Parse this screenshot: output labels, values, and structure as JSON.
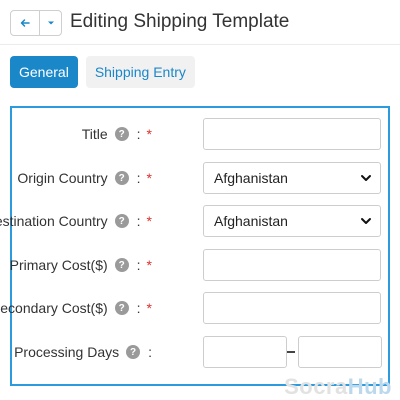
{
  "header": {
    "title": "Editing Shipping Template",
    "back_icon": "arrow-left-icon",
    "dropdown_icon": "caret-down-icon"
  },
  "tabs": [
    {
      "label": "General",
      "active": true
    },
    {
      "label": "Shipping Entry",
      "active": false
    }
  ],
  "form": {
    "title": {
      "label": "Title",
      "value": ""
    },
    "origin_country": {
      "label": "Origin Country",
      "value": "Afghanistan"
    },
    "destination_country": {
      "label": "Destination Country",
      "value": "Afghanistan"
    },
    "primary_cost": {
      "label": "Primary Cost($)",
      "value": ""
    },
    "secondary_cost": {
      "label": "Secondary Cost($)",
      "value": ""
    },
    "processing_days": {
      "label": "Processing Days",
      "min": "",
      "max": ""
    }
  },
  "symbols": {
    "help": "?",
    "colon": ":",
    "required": "*"
  },
  "watermark": {
    "part1": "Socra",
    "part2": "Hub"
  },
  "colors": {
    "accent": "#1a87c9",
    "panel_border": "#2b9bdd",
    "required": "#d9302c"
  }
}
